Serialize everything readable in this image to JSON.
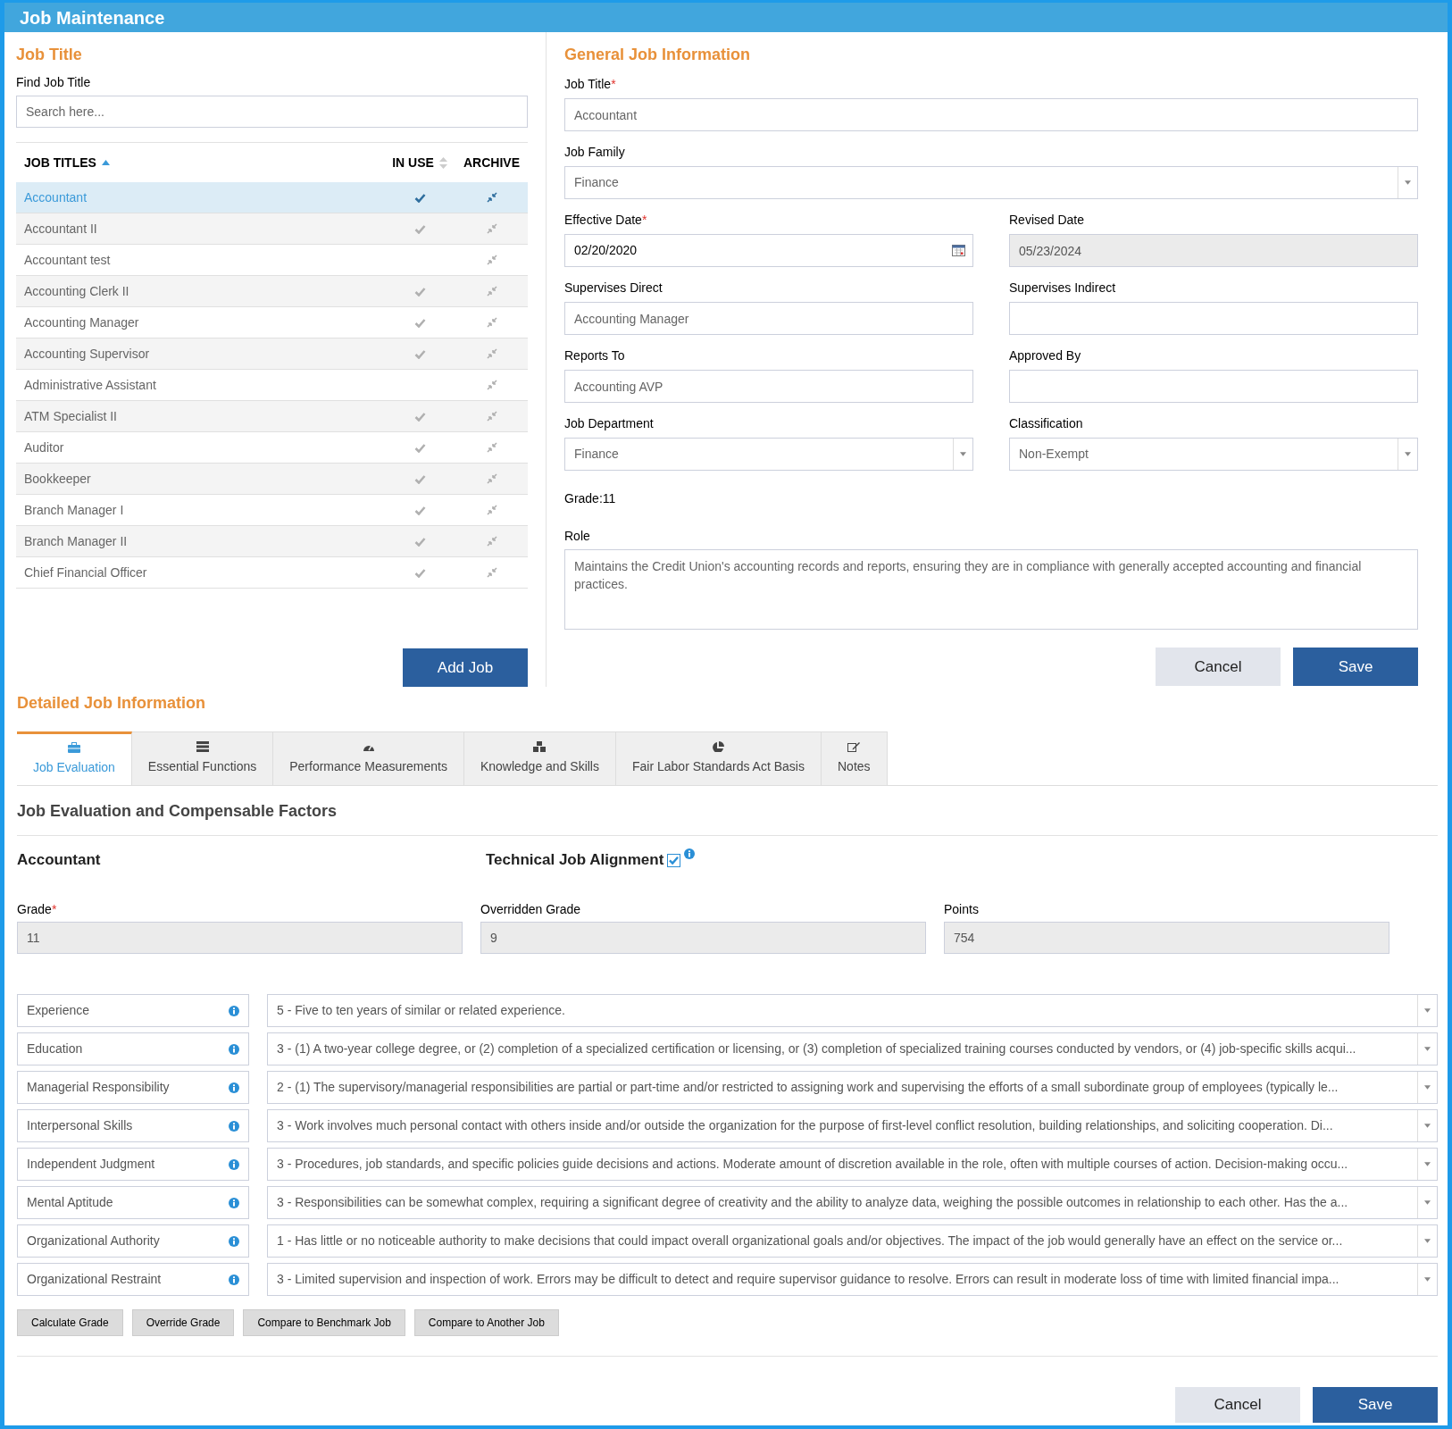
{
  "window": {
    "title": "Job Maintenance"
  },
  "job_title_panel": {
    "heading": "Job Title",
    "search_label": "Find Job Title",
    "search_placeholder": "Search here...",
    "columns": [
      {
        "label": "JOB TITLES",
        "sort_active": true
      },
      {
        "label": "IN USE",
        "sort_active": false
      },
      {
        "label": "ARCHIVE"
      }
    ],
    "rows": [
      {
        "title": "Accountant",
        "in_use": true,
        "selected": true
      },
      {
        "title": "Accountant II",
        "in_use": true,
        "selected": false
      },
      {
        "title": "Accountant test",
        "in_use": false,
        "selected": false
      },
      {
        "title": "Accounting Clerk II",
        "in_use": true,
        "selected": false
      },
      {
        "title": "Accounting Manager",
        "in_use": true,
        "selected": false
      },
      {
        "title": "Accounting Supervisor",
        "in_use": true,
        "selected": false
      },
      {
        "title": "Administrative Assistant",
        "in_use": false,
        "selected": false
      },
      {
        "title": "ATM Specialist II",
        "in_use": true,
        "selected": false
      },
      {
        "title": "Auditor",
        "in_use": true,
        "selected": false
      },
      {
        "title": "Bookkeeper",
        "in_use": true,
        "selected": false
      },
      {
        "title": "Branch Manager I",
        "in_use": true,
        "selected": false
      },
      {
        "title": "Branch Manager II",
        "in_use": true,
        "selected": false
      },
      {
        "title": "Chief Financial Officer",
        "in_use": true,
        "selected": false
      }
    ],
    "add_button": "Add Job"
  },
  "general": {
    "heading": "General Job Information",
    "field_rows": [
      [
        {
          "label": "Job Title",
          "required_mark": "*",
          "kind": "text",
          "value": "Accountant"
        }
      ],
      [
        {
          "label": "Job Family",
          "kind": "select",
          "value": "Finance"
        }
      ],
      [
        {
          "label": "Effective Date",
          "required_mark": "*",
          "kind": "date",
          "value": "02/20/2020"
        },
        {
          "label": "Revised Date",
          "kind": "readonly",
          "value": "05/23/2024"
        }
      ],
      [
        {
          "label": "Supervises Direct",
          "kind": "text",
          "value": "Accounting Manager"
        },
        {
          "label": "Supervises Indirect",
          "kind": "text"
        }
      ],
      [
        {
          "label": "Reports To",
          "kind": "text",
          "value": "Accounting AVP"
        },
        {
          "label": "Approved By",
          "kind": "text"
        }
      ],
      [
        {
          "label": "Job Department",
          "kind": "select",
          "value": "Finance"
        },
        {
          "label": "Classification",
          "kind": "select",
          "value": "Non-Exempt"
        }
      ]
    ],
    "grade_text": "Grade:11",
    "role_label": "Role",
    "role_text": "Maintains the Credit Union's accounting records and reports, ensuring they are in compliance with generally accepted accounting and financial practices.",
    "buttons": [
      "Cancel",
      "Save"
    ]
  },
  "detailed": {
    "heading": "Detailed Job Information",
    "tabs": [
      {
        "label": "Job Evaluation",
        "selected": true
      },
      {
        "label": "Essential Functions",
        "selected": false
      },
      {
        "label": "Performance Measurements",
        "selected": false
      },
      {
        "label": "Knowledge and Skills",
        "selected": false
      },
      {
        "label": "Fair Labor Standards Act Basis",
        "selected": false
      },
      {
        "label": "Notes",
        "selected": false
      }
    ],
    "section_title": "Job Evaluation and Compensable Factors",
    "job_name": "Accountant",
    "technical_alignment": {
      "label": "Technical Job Alignment",
      "checked": true
    },
    "grade_fields": [
      {
        "label": "Grade",
        "required_mark": "*",
        "value": "11"
      },
      {
        "label": "Overridden Grade",
        "value": "9"
      },
      {
        "label": "Points",
        "value": "754"
      }
    ],
    "factors": [
      {
        "label": "Experience",
        "value": "5 - Five to ten years of similar or related experience."
      },
      {
        "label": "Education",
        "value": "3 - (1) A two-year college degree, or (2) completion of a specialized certification or licensing, or (3) completion of specialized training courses conducted by vendors, or (4) job-specific skills acqui..."
      },
      {
        "label": "Managerial Responsibility",
        "value": "2 - (1) The supervisory/managerial responsibilities are partial or part-time and/or restricted to assigning work and supervising the efforts of a small subordinate group of employees (typically le..."
      },
      {
        "label": "Interpersonal Skills",
        "value": "3 - Work involves much personal contact with others inside and/or outside the organization for the purpose of first-level conflict resolution, building relationships, and soliciting cooperation. Di..."
      },
      {
        "label": "Independent Judgment",
        "value": "3 - Procedures, job standards, and specific policies guide decisions and actions. Moderate amount of discretion available in the role, often with multiple courses of action. Decision-making occu..."
      },
      {
        "label": "Mental Aptitude",
        "value": "3 - Responsibilities can be somewhat complex, requiring a significant degree of creativity and the ability to analyze data, weighing the possible outcomes in relationship to each other. Has the a..."
      },
      {
        "label": "Organizational Authority",
        "value": "1 - Has little or no noticeable authority to make decisions that could impact overall organizational goals and/or objectives. The impact of the job would generally have an effect on the service or..."
      },
      {
        "label": "Organizational Restraint",
        "value": "3 - Limited supervision and inspection of work. Errors may be difficult to detect and require supervisor guidance to resolve. Errors can result in moderate loss of time with limited financial impa..."
      }
    ],
    "action_buttons": [
      "Calculate Grade",
      "Override Grade",
      "Compare to Benchmark Job",
      "Compare to Another Job"
    ],
    "footer_buttons": [
      "Cancel",
      "Save"
    ]
  }
}
